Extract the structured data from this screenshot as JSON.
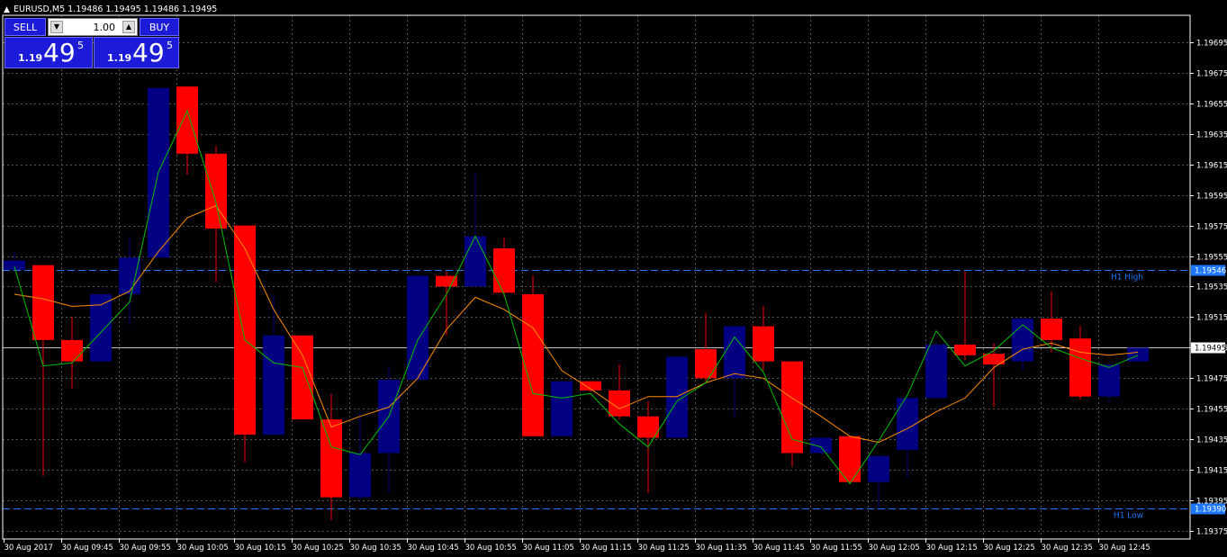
{
  "header": {
    "symbol_info": "EURUSD,M5  1.19486 1.19495 1.19486 1.19495"
  },
  "trade_panel": {
    "sell_label": "SELL",
    "buy_label": "BUY",
    "lot": "1.00",
    "sell_price": {
      "small": "1.19",
      "big": "49",
      "sup": "5"
    },
    "buy_price": {
      "small": "1.19",
      "big": "49",
      "sup": "5"
    }
  },
  "colors": {
    "background": "#000000",
    "grid": "#555555",
    "bull": "#000080",
    "bear": "#ff0000",
    "ma_fast": "#00c000",
    "ma_slow": "#ff8c00",
    "level_line": "#1e78ff",
    "axis_text": "#ffffff",
    "current_price_label_bg": "#ffffff"
  },
  "chart_data": {
    "type": "candlestick",
    "symbol": "EURUSD",
    "timeframe": "M5",
    "ylim": [
      1.19375,
      1.19705
    ],
    "grid": true,
    "y_ticks": [
      "1.19695",
      "1.19675",
      "1.19655",
      "1.19635",
      "1.19615",
      "1.19595",
      "1.19575",
      "1.19555",
      "1.19535",
      "1.19515",
      "1.19495",
      "1.19475",
      "1.19455",
      "1.19435",
      "1.19415",
      "1.19395",
      "1.19375"
    ],
    "x_ticks": [
      {
        "label": "30 Aug 2017",
        "bar": 0
      },
      {
        "label": "30 Aug 09:45",
        "bar": 2
      },
      {
        "label": "30 Aug 09:55",
        "bar": 4
      },
      {
        "label": "30 Aug 10:05",
        "bar": 6
      },
      {
        "label": "30 Aug 10:15",
        "bar": 8
      },
      {
        "label": "30 Aug 10:25",
        "bar": 10
      },
      {
        "label": "30 Aug 10:35",
        "bar": 12
      },
      {
        "label": "30 Aug 10:45",
        "bar": 14
      },
      {
        "label": "30 Aug 10:55",
        "bar": 16
      },
      {
        "label": "30 Aug 11:05",
        "bar": 18
      },
      {
        "label": "30 Aug 11:15",
        "bar": 20
      },
      {
        "label": "30 Aug 11:25",
        "bar": 22
      },
      {
        "label": "30 Aug 11:35",
        "bar": 24
      },
      {
        "label": "30 Aug 11:45",
        "bar": 26
      },
      {
        "label": "30 Aug 11:55",
        "bar": 28
      },
      {
        "label": "30 Aug 12:05",
        "bar": 30
      },
      {
        "label": "30 Aug 12:15",
        "bar": 32
      },
      {
        "label": "30 Aug 12:25",
        "bar": 34
      },
      {
        "label": "30 Aug 12:35",
        "bar": 36
      },
      {
        "label": "30 Aug 12:45",
        "bar": 38
      }
    ],
    "candles": [
      {
        "o": 1.19546,
        "h": 1.19557,
        "l": 1.19546,
        "c": 1.19552
      },
      {
        "o": 1.19549,
        "h": 1.19549,
        "l": 1.19411,
        "c": 1.195
      },
      {
        "o": 1.195,
        "h": 1.19515,
        "l": 1.19468,
        "c": 1.19486
      },
      {
        "o": 1.19486,
        "h": 1.1953,
        "l": 1.19486,
        "c": 1.1953
      },
      {
        "o": 1.1953,
        "h": 1.19568,
        "l": 1.1951,
        "c": 1.19554
      },
      {
        "o": 1.19554,
        "h": 1.19665,
        "l": 1.19554,
        "c": 1.19665
      },
      {
        "o": 1.19666,
        "h": 1.19666,
        "l": 1.19608,
        "c": 1.19622
      },
      {
        "o": 1.19622,
        "h": 1.19627,
        "l": 1.19538,
        "c": 1.19573
      },
      {
        "o": 1.19575,
        "h": 1.19575,
        "l": 1.1942,
        "c": 1.19438
      },
      {
        "o": 1.19438,
        "h": 1.19529,
        "l": 1.19438,
        "c": 1.19503
      },
      {
        "o": 1.19503,
        "h": 1.19503,
        "l": 1.19448,
        "c": 1.19448
      },
      {
        "o": 1.19448,
        "h": 1.19465,
        "l": 1.19382,
        "c": 1.19397
      },
      {
        "o": 1.19397,
        "h": 1.19453,
        "l": 1.19395,
        "c": 1.19426
      },
      {
        "o": 1.19426,
        "h": 1.19483,
        "l": 1.194,
        "c": 1.19474
      },
      {
        "o": 1.19474,
        "h": 1.19543,
        "l": 1.19474,
        "c": 1.19542
      },
      {
        "o": 1.19542,
        "h": 1.19545,
        "l": 1.19503,
        "c": 1.19535
      },
      {
        "o": 1.19535,
        "h": 1.19609,
        "l": 1.19535,
        "c": 1.19568
      },
      {
        "o": 1.1956,
        "h": 1.19567,
        "l": 1.19528,
        "c": 1.19531
      },
      {
        "o": 1.1953,
        "h": 1.19542,
        "l": 1.19437,
        "c": 1.19437
      },
      {
        "o": 1.19437,
        "h": 1.19473,
        "l": 1.19437,
        "c": 1.19473
      },
      {
        "o": 1.19473,
        "h": 1.19473,
        "l": 1.19466,
        "c": 1.19467
      },
      {
        "o": 1.19467,
        "h": 1.19484,
        "l": 1.19448,
        "c": 1.1945
      },
      {
        "o": 1.1945,
        "h": 1.1946,
        "l": 1.194,
        "c": 1.19436
      },
      {
        "o": 1.19436,
        "h": 1.1949,
        "l": 1.19436,
        "c": 1.19489
      },
      {
        "o": 1.19494,
        "h": 1.19518,
        "l": 1.19473,
        "c": 1.19475
      },
      {
        "o": 1.19475,
        "h": 1.19509,
        "l": 1.1945,
        "c": 1.19509
      },
      {
        "o": 1.19509,
        "h": 1.19522,
        "l": 1.1948,
        "c": 1.19486
      },
      {
        "o": 1.19486,
        "h": 1.19486,
        "l": 1.19417,
        "c": 1.19426
      },
      {
        "o": 1.19426,
        "h": 1.19436,
        "l": 1.19425,
        "c": 1.19436
      },
      {
        "o": 1.19437,
        "h": 1.19437,
        "l": 1.19407,
        "c": 1.19407
      },
      {
        "o": 1.19407,
        "h": 1.19425,
        "l": 1.1939,
        "c": 1.19424
      },
      {
        "o": 1.19428,
        "h": 1.19463,
        "l": 1.1941,
        "c": 1.19462
      },
      {
        "o": 1.19462,
        "h": 1.19499,
        "l": 1.19462,
        "c": 1.19497
      },
      {
        "o": 1.19497,
        "h": 1.19545,
        "l": 1.19487,
        "c": 1.1949
      },
      {
        "o": 1.19491,
        "h": 1.19498,
        "l": 1.19456,
        "c": 1.19484
      },
      {
        "o": 1.19486,
        "h": 1.19515,
        "l": 1.1948,
        "c": 1.19514
      },
      {
        "o": 1.19514,
        "h": 1.19532,
        "l": 1.19492,
        "c": 1.195
      },
      {
        "o": 1.19501,
        "h": 1.19509,
        "l": 1.19461,
        "c": 1.19463
      },
      {
        "o": 1.19463,
        "h": 1.19484,
        "l": 1.1946,
        "c": 1.19484
      },
      {
        "o": 1.19486,
        "h": 1.19495,
        "l": 1.19486,
        "c": 1.19495
      }
    ],
    "ma_fast": [
      1.19548,
      1.19483,
      1.19485,
      1.19505,
      1.19525,
      1.1961,
      1.1965,
      1.1959,
      1.195,
      1.19485,
      1.19482,
      1.1943,
      1.19425,
      1.1945,
      1.195,
      1.1953,
      1.19568,
      1.1953,
      1.19465,
      1.19462,
      1.19465,
      1.19445,
      1.1943,
      1.1946,
      1.19472,
      1.19502,
      1.19479,
      1.19435,
      1.1943,
      1.19406,
      1.19434,
      1.19464,
      1.19506,
      1.19483,
      1.19493,
      1.1951,
      1.19495,
      1.19488,
      1.19482,
      1.1949
    ],
    "ma_slow": [
      1.1953,
      1.19527,
      1.19522,
      1.19523,
      1.19532,
      1.19558,
      1.1958,
      1.19588,
      1.1956,
      1.1952,
      1.1949,
      1.19443,
      1.1945,
      1.19456,
      1.19475,
      1.19507,
      1.19528,
      1.1952,
      1.19508,
      1.1948,
      1.19468,
      1.19455,
      1.19463,
      1.19463,
      1.19472,
      1.19478,
      1.19475,
      1.19462,
      1.1945,
      1.19437,
      1.19433,
      1.19442,
      1.19453,
      1.19462,
      1.19482,
      1.19494,
      1.19498,
      1.19492,
      1.1949,
      1.19492
    ],
    "levels": [
      {
        "price": 1.19546,
        "label": "H1 High",
        "price_label": "1.19546"
      },
      {
        "price": 1.1939,
        "label": "H1 Low",
        "price_label": "1.19390"
      }
    ],
    "current_price": {
      "price": 1.19495,
      "label": "1.19495"
    }
  }
}
